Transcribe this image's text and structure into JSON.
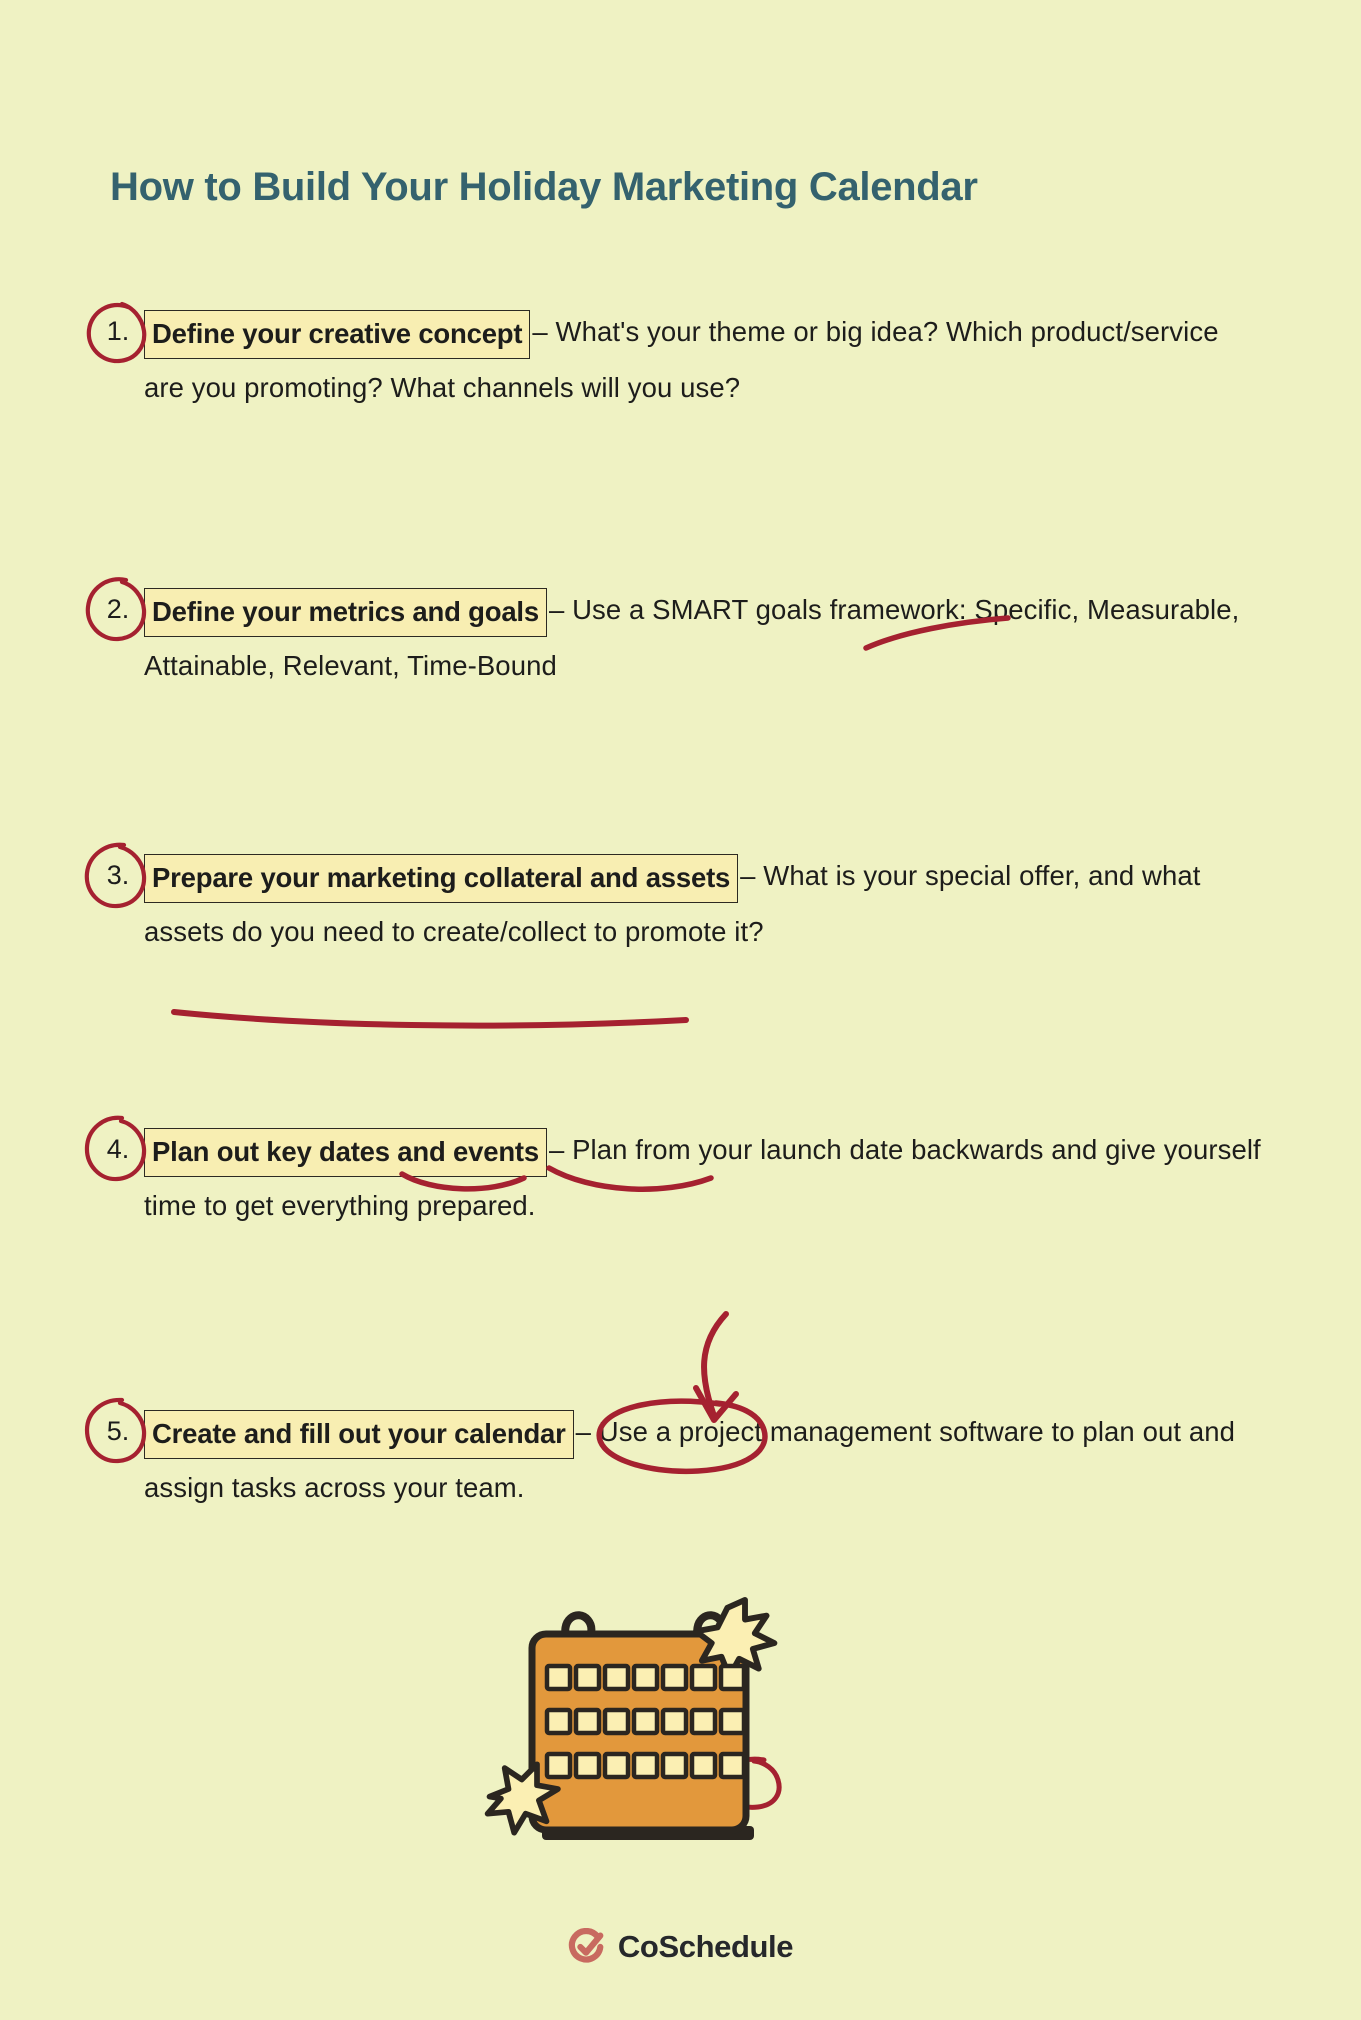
{
  "background_color": "#eff2c3",
  "title": "How to Build Your Holiday Marketing Calendar",
  "title_color": "#34626e",
  "accent_color": "#a52130",
  "highlight_fill": "#f8eeb2",
  "calendar_color": "#e2983c",
  "steps": [
    {
      "number": "1.",
      "heading": "Define your creative concept",
      "body": "– What's your theme or big idea? Which product/service are you promoting? What channels will you use?",
      "annotations": [
        "circled-number"
      ]
    },
    {
      "number": "2.",
      "heading": "Define your metrics and goals",
      "body": "– Use a SMART goals framework: Specific, Measurable, Attainable, Relevant, Time-Bound",
      "annotations": [
        "circled-number",
        "underline-smart"
      ]
    },
    {
      "number": "3.",
      "heading": "Prepare your marketing collateral and assets",
      "body": "– What is your special offer, and what assets do you need to create/collect to promote it?",
      "annotations": [
        "circled-number",
        "underline-create-collect"
      ]
    },
    {
      "number": "4.",
      "heading": "Plan out key dates and events",
      "body": "– Plan from your launch date backwards and give yourself time to get everything prepared.",
      "annotations": [
        "circled-number",
        "underline-dates",
        "underline-events"
      ]
    },
    {
      "number": "5.",
      "heading": "Create and fill out your calendar",
      "body": "– Use a project management software to plan out and assign tasks across your team.",
      "annotations": [
        "circled-number",
        "circle-calendar",
        "arrow-to-calendar"
      ]
    }
  ],
  "illustration": {
    "name": "desk-calendar",
    "rows": 3,
    "columns": 7,
    "circled_day_row": 3,
    "circled_day_column": 6,
    "stars": 2
  },
  "logo": {
    "text": "CoSchedule",
    "mark": "coschedule-check-icon",
    "mark_color": "#c86a60"
  }
}
